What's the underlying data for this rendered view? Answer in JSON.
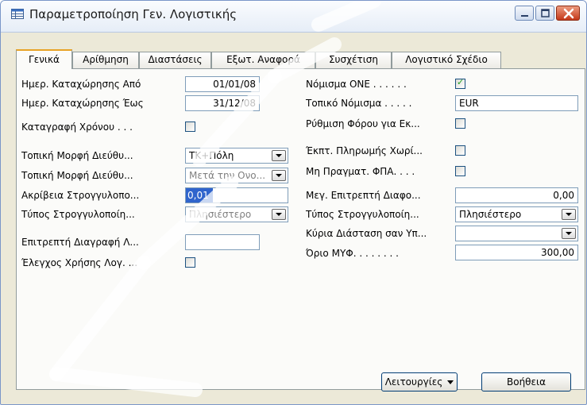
{
  "window": {
    "title": "Παραμετροποίηση Γεν. Λογιστικής",
    "icons": {
      "app": "table-icon",
      "minimize": "minimize-icon",
      "maximize": "maximize-icon",
      "close": "close-icon"
    }
  },
  "tabs": [
    {
      "label": "Γενικά",
      "active": true
    },
    {
      "label": "Αρίθμηση",
      "active": false
    },
    {
      "label": "Διαστάσεις",
      "active": false
    },
    {
      "label": "Εξωτ. Αναφορά",
      "active": false
    },
    {
      "label": "Συσχέτιση",
      "active": false
    },
    {
      "label": "Λογιστικό Σχέδιο",
      "active": false
    }
  ],
  "left": {
    "posting_from": {
      "label": "Ημερ. Καταχώρησης Από",
      "value": "01/01/08"
    },
    "posting_to": {
      "label": "Ημερ. Καταχώρησης Έως",
      "value": "31/12/08"
    },
    "register_time": {
      "label": "Καταγραφή Χρόνου . . .",
      "checked": false
    },
    "local_address_1": {
      "label": "Τοπική Μορφή Διεύθυ...",
      "value": "ΤΚ+Πόλη"
    },
    "local_address_2": {
      "label": "Τοπική Μορφή Διεύθυ...",
      "value": "Μετά την Ονο..."
    },
    "rounding_precision": {
      "label": "Ακρίβεια Στρογγυλοπο...",
      "value": "0,01"
    },
    "rounding_type": {
      "label": "Τύπος Στρογγυλοποίη...",
      "value": "Πλησιέστερο"
    },
    "allow_deletion": {
      "label": "Επιτρεπτή Διαγραφή Λ...",
      "value": ""
    },
    "check_account_usage": {
      "label": "Έλεγχος Χρήσης Λογ. ...",
      "checked": false
    }
  },
  "right": {
    "emu_currency": {
      "label": "Νόμισμα ΟΝΕ . . . . . .",
      "checked": true
    },
    "local_currency": {
      "label": "Τοπικό Νόμισμα . . . . .",
      "value": "EUR"
    },
    "tax_setting": {
      "label": "Ρύθμιση Φόρου για Εκ...",
      "checked": false
    },
    "payment_discount": {
      "label": "Έκπτ. Πληρωμής Χωρί...",
      "checked": false
    },
    "non_realized_vat": {
      "label": "Μη Πραγματ. ΦΠΑ. . . .",
      "checked": false
    },
    "max_allowed_diff": {
      "label": "Μεγ. Επιτρεπτή Διαφο...",
      "value": "0,00"
    },
    "rounding_type": {
      "label": "Τύπος Στρογγυλοποίη...",
      "value": "Πλησιέστερο"
    },
    "main_dimension": {
      "label": "Κύρια Διάσταση σαν Υπ...",
      "value": ""
    },
    "vat_limit": {
      "label": "Όριο ΜΥΦ. . . . . . . .",
      "value": "300,00"
    }
  },
  "footer": {
    "functions_label": "Λειτουργίες",
    "help_label": "Βοήθεια"
  },
  "colors": {
    "tab_highlight": "#e8a326",
    "selection": "#2f64cc",
    "close_button": "#c4381a",
    "check_mark": "#21a121"
  }
}
